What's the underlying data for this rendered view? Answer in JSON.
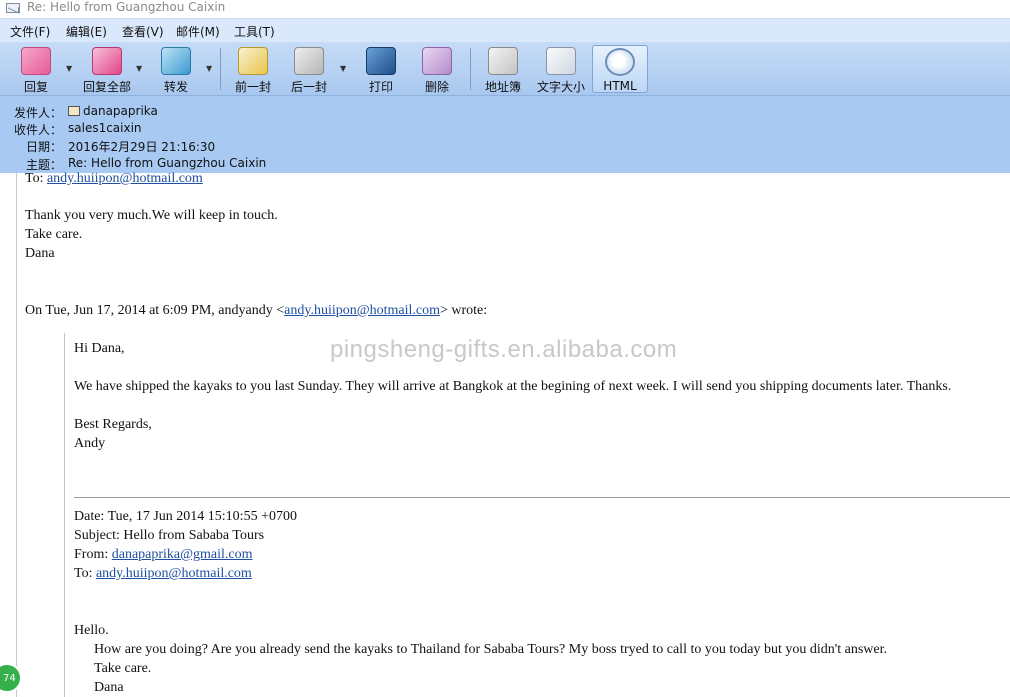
{
  "window": {
    "title": "Re: Hello from Guangzhou Caixin"
  },
  "menu": [
    "文件(F)",
    "编辑(E)",
    "查看(V)",
    "邮件(M)",
    "工具(T)"
  ],
  "toolbar": {
    "reply": "回复",
    "reply_all": "回复全部",
    "forward": "转发",
    "previous": "前一封",
    "next": "后一封",
    "print": "打印",
    "delete": "删除",
    "address_book": "地址簿",
    "font_size": "文字大小",
    "html": "HTML"
  },
  "header": {
    "from_label": "发件人：",
    "from_value": "danapaprika",
    "to_label": "收件人：",
    "to_value": "sales1caixin",
    "date_label": "日期：",
    "date_value": "2016年2月29日 21:16:30",
    "subject_label": "主题：",
    "subject_value": "Re: Hello from Guangzhou Caixin"
  },
  "body": {
    "to_prefix": "To: ",
    "to_email": "andy.huiipon@hotmail.com",
    "line1": "Thank you very much.We will keep in touch.",
    "line2": "Take care.",
    "line3": "Dana",
    "on_prefix": "On Tue, Jun 17, 2014 at 6:09 PM, andyandy <",
    "on_email": "andy.huiipon@hotmail.com",
    "on_suffix": "> wrote:",
    "q_greeting": "Hi Dana,",
    "q_text": "We have shipped the kayaks to you last Sunday. They will arrive at Bangkok at the begining of next week. I will send you shipping documents later. Thanks.",
    "q_regards": "Best Regards,",
    "q_name": "Andy",
    "date_line": "Date: Tue, 17 Jun 2014 15:10:55 +0700",
    "subject_line": "Subject: Hello from Sababa Tours",
    "from_prefix": "From: ",
    "from_email": "danapaprika@gmail.com",
    "to2_prefix": "To: ",
    "to2_email": "andy.huiipon@hotmail.com",
    "hello": "Hello.",
    "how_line": "How are you doing? Are you already send the kayaks to Thailand for Sababa Tours? My boss tryed to call to you today but you didn't answer.",
    "take_care": "Take care.",
    "dana": "Dana"
  },
  "watermark": "pingsheng-gifts.en.alibaba.com",
  "badge": "74",
  "colors": {
    "menubar": "#d9e8fb",
    "toolbar": "#b8d4f4",
    "header": "#a8c9f2",
    "link": "#1e4fa0"
  }
}
